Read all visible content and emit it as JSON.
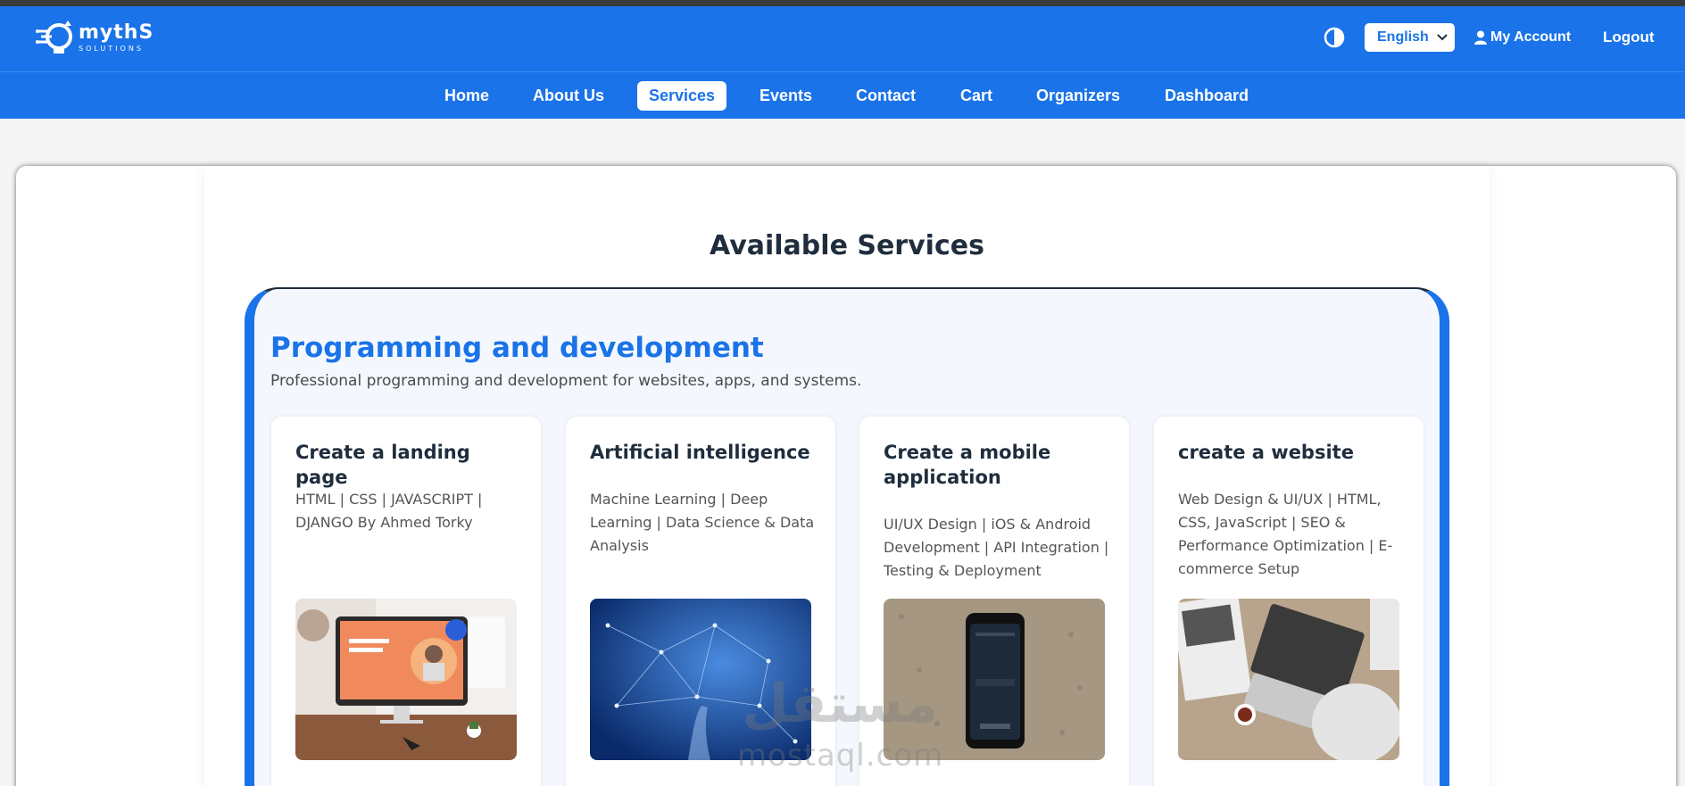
{
  "header": {
    "logo": {
      "name": "mythS",
      "sub": "SOLUTIONS"
    },
    "theme_icon": "contrast-icon",
    "language": {
      "selected": "English"
    },
    "account_label": "My Account",
    "logout_label": "Logout"
  },
  "nav": {
    "items": [
      {
        "label": "Home"
      },
      {
        "label": "About Us"
      },
      {
        "label": "Services",
        "active": true
      },
      {
        "label": "Events"
      },
      {
        "label": "Contact"
      },
      {
        "label": "Cart"
      },
      {
        "label": "Organizers"
      },
      {
        "label": "Dashboard"
      }
    ]
  },
  "main": {
    "title": "Available Services",
    "category": {
      "title": "Programming and development",
      "description": "Professional programming and development for websites, apps, and systems.",
      "services": [
        {
          "title": "Create a landing page",
          "description": "HTML | CSS | JAVASCRIPT | DJANGO By Ahmed Torky",
          "image": "imac-landing-page-image"
        },
        {
          "title": "Artificial intelligence",
          "description": "Machine Learning | Deep Learning | Data Science & Data Analysis",
          "image": "ai-network-hand-image"
        },
        {
          "title": "Create a mobile application",
          "description": "UI/UX Design | iOS & Android Development | API Integration | Testing & Deployment",
          "image": "smartphone-image"
        },
        {
          "title": "create a website",
          "description": "Web Design & UI/UX | HTML, CSS, JavaScript | SEO & Performance Optimization | E-commerce Setup",
          "image": "laptop-typing-image"
        }
      ]
    }
  },
  "watermark": {
    "text": "mostaql.com",
    "arabic": "مستقل"
  },
  "colors": {
    "primary": "#1a73e8",
    "heading": "#1f2d3d",
    "category_bg": "#f4f8fe"
  }
}
